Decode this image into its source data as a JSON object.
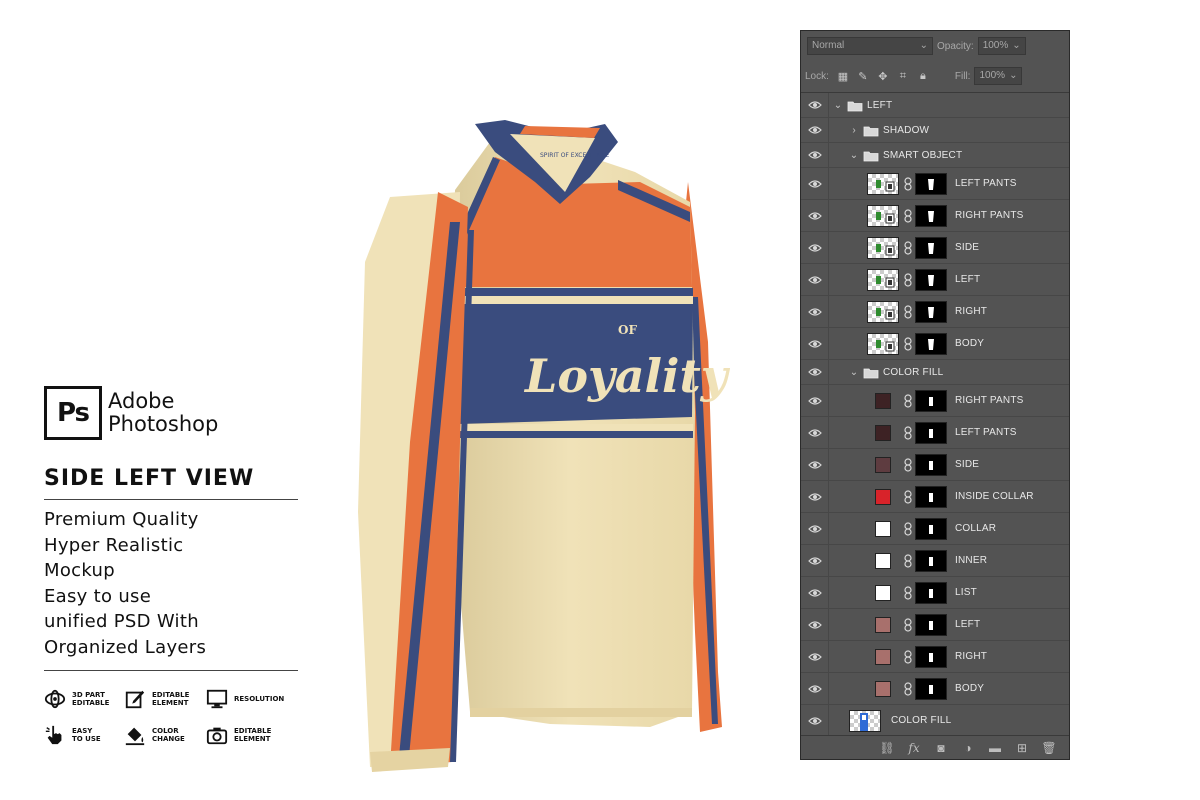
{
  "branding": {
    "logo_text": "Ps",
    "product_name_line1": "Adobe",
    "product_name_line2": "Photoshop",
    "view_title": "SIDE LEFT VIEW"
  },
  "features": [
    "Premium Quality",
    "Hyper Realistic",
    "Mockup",
    "Easy to use",
    "unified PSD With",
    "Organized Layers"
  ],
  "badges": [
    {
      "icon": "3d-part-icon",
      "label": "3D PART\nEDITABLE"
    },
    {
      "icon": "edit-icon",
      "label": "EDITABLE\nELEMENT"
    },
    {
      "icon": "monitor-icon",
      "label": "RESOLUTION"
    },
    {
      "icon": "hand-pointer-icon",
      "label": "EASY\nTO USE"
    },
    {
      "icon": "paint-bucket-icon",
      "label": "COLOR\nCHANGE"
    },
    {
      "icon": "camera-icon",
      "label": "EDITABLE\nELEMENT"
    }
  ],
  "jersey": {
    "text_small": "OF",
    "text_main": "Loyality",
    "collar_text": "SPIRIT OF EXCELLENCE",
    "colors": {
      "base": "#f0e2b8",
      "accent": "#e8743f",
      "navy": "#3a4c7e"
    }
  },
  "layers_panel": {
    "blend_mode": "Normal",
    "opacity_label": "Opacity:",
    "opacity_value": "100%",
    "lock_label": "Lock:",
    "fill_label": "Fill:",
    "fill_value": "100%",
    "layers": [
      {
        "name": "LEFT",
        "kind": "group",
        "expanded": true,
        "indent": 0
      },
      {
        "name": "SHADOW",
        "kind": "group",
        "expanded": false,
        "indent": 1
      },
      {
        "name": "SMART OBJECT",
        "kind": "group",
        "expanded": true,
        "indent": 1
      },
      {
        "name": "LEFT PANTS",
        "kind": "smart",
        "indent": 2
      },
      {
        "name": "RIGHT PANTS",
        "kind": "smart",
        "indent": 2
      },
      {
        "name": "SIDE",
        "kind": "smart",
        "indent": 2
      },
      {
        "name": "LEFT",
        "kind": "smart",
        "indent": 2
      },
      {
        "name": "RIGHT",
        "kind": "smart",
        "indent": 2
      },
      {
        "name": "BODY",
        "kind": "smart",
        "indent": 2
      },
      {
        "name": "COLOR FILL",
        "kind": "group",
        "expanded": true,
        "indent": 1
      },
      {
        "name": "RIGHT PANTS",
        "kind": "fill",
        "color": "#3d2224",
        "indent": 2
      },
      {
        "name": "LEFT PANTS",
        "kind": "fill",
        "color": "#3d2224",
        "indent": 2
      },
      {
        "name": "SIDE",
        "kind": "fill",
        "color": "#5e3c40",
        "indent": 2
      },
      {
        "name": "INSIDE COLLAR",
        "kind": "fill",
        "color": "#d8232a",
        "indent": 2
      },
      {
        "name": "COLLAR",
        "kind": "fill",
        "color": "#ffffff",
        "indent": 2
      },
      {
        "name": "INNER",
        "kind": "fill",
        "color": "#ffffff",
        "indent": 2
      },
      {
        "name": "LIST",
        "kind": "fill",
        "color": "#ffffff",
        "indent": 2
      },
      {
        "name": "LEFT",
        "kind": "fill",
        "color": "#a8706c",
        "indent": 2
      },
      {
        "name": "RIGHT",
        "kind": "fill",
        "color": "#a8706c",
        "indent": 2
      },
      {
        "name": "BODY",
        "kind": "fill",
        "color": "#a8706c",
        "indent": 2
      },
      {
        "name": "COLOR FILL",
        "kind": "bg",
        "indent": 0
      }
    ],
    "footer_icons": [
      "link-layers-icon",
      "fx-icon",
      "add-mask-icon",
      "adjustment-layer-icon",
      "new-group-icon",
      "new-layer-icon",
      "trash-icon"
    ]
  }
}
